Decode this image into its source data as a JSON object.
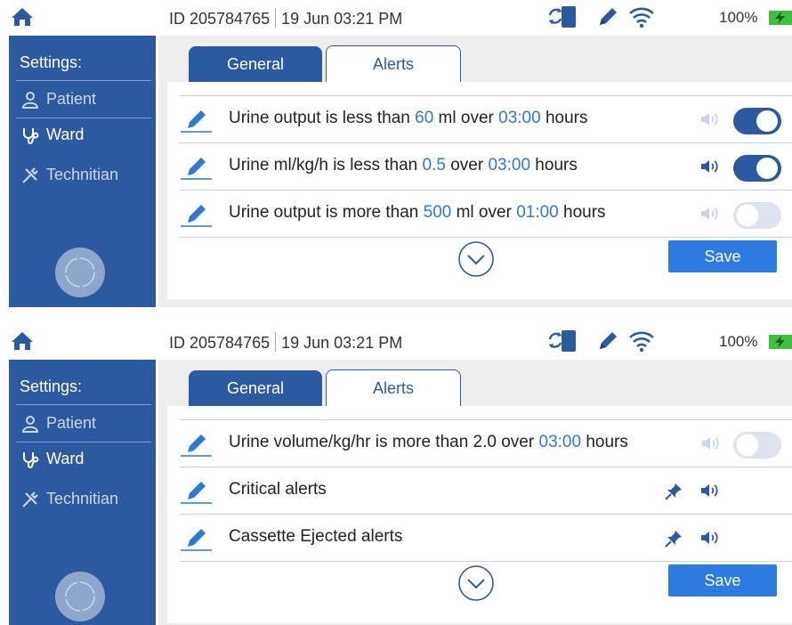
{
  "status": {
    "id_text": "ID 205784765",
    "datetime": "19 Jun  03:21 PM",
    "battery": "100%"
  },
  "sidebar": {
    "title": "Settings:",
    "items": [
      {
        "label": "Patient",
        "icon": "person-icon"
      },
      {
        "label": "Ward",
        "icon": "stethoscope-icon"
      },
      {
        "label": "Technitian",
        "icon": "tools-icon"
      }
    ],
    "active": "Ward"
  },
  "tabs": [
    {
      "label": "General",
      "selected": false
    },
    {
      "label": "Alerts",
      "selected": true
    }
  ],
  "screen1": {
    "rows": [
      {
        "pre": "Urine output is less than ",
        "v1": "60",
        "mid": " ml over ",
        "v2": "03:00",
        "post": " hours",
        "sound": "muted",
        "toggle": "on"
      },
      {
        "pre": "Urine ml/kg/h is less than ",
        "v1": "0.5",
        "mid": " over ",
        "v2": "03:00",
        "post": " hours",
        "sound": "active",
        "toggle": "on"
      },
      {
        "pre": "Urine output is more than ",
        "v1": "500",
        "mid": " ml over ",
        "v2": "01:00",
        "post": " hours",
        "sound": "muted",
        "toggle": "off"
      }
    ],
    "save_label": "Save"
  },
  "screen2": {
    "rows": [
      {
        "pre": "Urine volume/kg/hr is more than 2.0 over ",
        "v2": "03:00",
        "post": " hours",
        "sound": "muted",
        "toggle": "off"
      },
      {
        "label": "Critical alerts",
        "pinned": true,
        "sound": "active"
      },
      {
        "label": "Cassette Ejected alerts",
        "pinned": true,
        "sound": "active"
      }
    ],
    "save_label": "Save"
  },
  "colors": {
    "primary": "#2c5aa0",
    "accent_value": "#2c7ad6",
    "save_button": "#2d7ae0",
    "battery_green": "#3fbf3f"
  }
}
